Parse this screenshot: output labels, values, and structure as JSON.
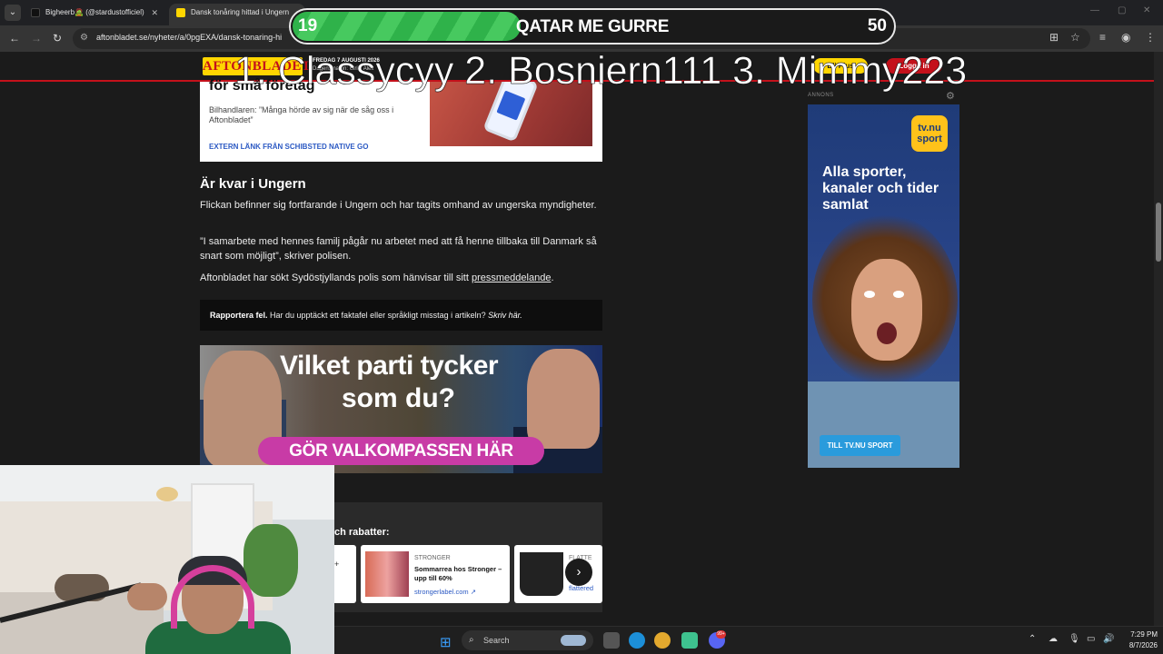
{
  "browser": {
    "tabs": [
      {
        "label": "Bigheerb🧟 (@stardustofficiel)"
      },
      {
        "label": "Dansk tonåring hittad i Ungern"
      }
    ],
    "url": "aftonbladet.se/nyheter/a/0pgEXA/dansk-tonaring-hi"
  },
  "site": {
    "logo": "AFTONBLADET",
    "date_line1": "FREDAG 7 AUGUSTI 2026",
    "date_line2": "Dagens namn: Ulrik, Alex",
    "plus_label": "Bli Plus",
    "login_label": "Logga in"
  },
  "promo": {
    "title": "för små företag",
    "subtitle": "Bilhandlaren: ”Många hörde av sig när de såg oss i Aftonbladet”",
    "source": "EXTERN LÄNK FRÅN SCHIBSTED NATIVE GO"
  },
  "article": {
    "heading": "Är kvar i Ungern",
    "p1": "Flickan befinner sig fortfarande i Ungern och har tagits omhand av ungerska myndigheter.",
    "p2": "”I samarbete med hennes familj pågår nu arbetet med att få henne tillbaka till Danmark så snart som möjligt”, skriver polisen.",
    "p3_text": "Aftonbladet har sökt Sydöstjyllands polis som hänvisar till sitt ",
    "p3_link": "pressmeddelande",
    "p3_end": "."
  },
  "report": {
    "bold": "Rapportera fel.",
    "text": " Har du upptäckt ett faktafel eller språkligt misstag i artikeln? ",
    "link": "Skriv här."
  },
  "valkompass": {
    "line1": "Vilket parti tycker",
    "line2": "som du?",
    "cta": "GÖR VALKOMPASSEN HÄR"
  },
  "rabatter": {
    "heading": "ch rabatter:",
    "cards": [
      {
        "brand": "STRONGER",
        "title": "Sommarrea hos Stronger – upp till 60%",
        "link": "strongerlabel.com ↗"
      },
      {
        "brand": "FLATTE",
        "link": "flattered"
      }
    ],
    "next_icon": "›"
  },
  "ad": {
    "label": "ANNONS",
    "logo_line1": "tv.nu",
    "logo_line2": "sport",
    "headline": "Alla sporter, kanaler och tider samlat",
    "cta": "TILL TV.NU SPORT"
  },
  "stream_overlay": {
    "score_left": "19",
    "score_right": "50",
    "title": "QATAR ME GURRE",
    "progress_fraction": 0.38,
    "leaderboard": "1. Classycyy 2. Bosniern111 3. Mimmy223"
  },
  "taskbar": {
    "search_placeholder": "Search",
    "time": "7:29 PM",
    "date": "8/7/2026",
    "badge": "99+"
  },
  "colors": {
    "accent_red": "#c4111b",
    "brand_yellow": "#ffd600",
    "progress_green": "#2fb24a"
  }
}
